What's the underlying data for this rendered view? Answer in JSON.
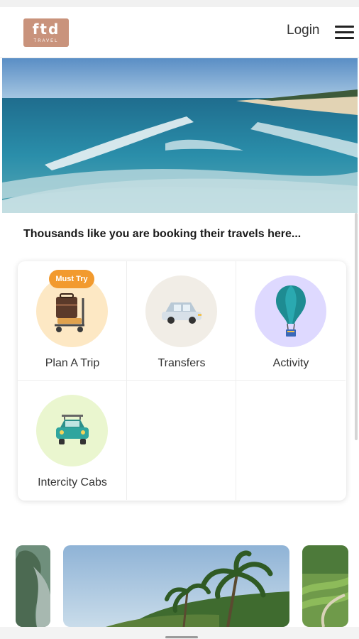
{
  "header": {
    "logo_text": "ftd",
    "logo_subtext": "TRAVEL",
    "login_label": "Login"
  },
  "hero": {
    "icon": "beach-photo"
  },
  "tagline": "Thousands like you are booking their travels here...",
  "categories": [
    {
      "label": "Plan A Trip",
      "badge": "Must Try",
      "icon": "luggage-trolley-icon",
      "bg": "#fde8c4"
    },
    {
      "label": "Transfers",
      "icon": "car-icon",
      "bg": "#f1ede6"
    },
    {
      "label": "Activity",
      "icon": "hot-air-balloon-icon",
      "bg": "#ded9ff"
    },
    {
      "label": "Intercity Cabs",
      "icon": "cab-icon",
      "bg": "#eaf6cf"
    }
  ],
  "carousel": {
    "slides": [
      "forest-photo",
      "palm-hill-photo",
      "tea-garden-photo"
    ]
  },
  "colors": {
    "brand": "#c9937c",
    "badge": "#f29a2e"
  }
}
